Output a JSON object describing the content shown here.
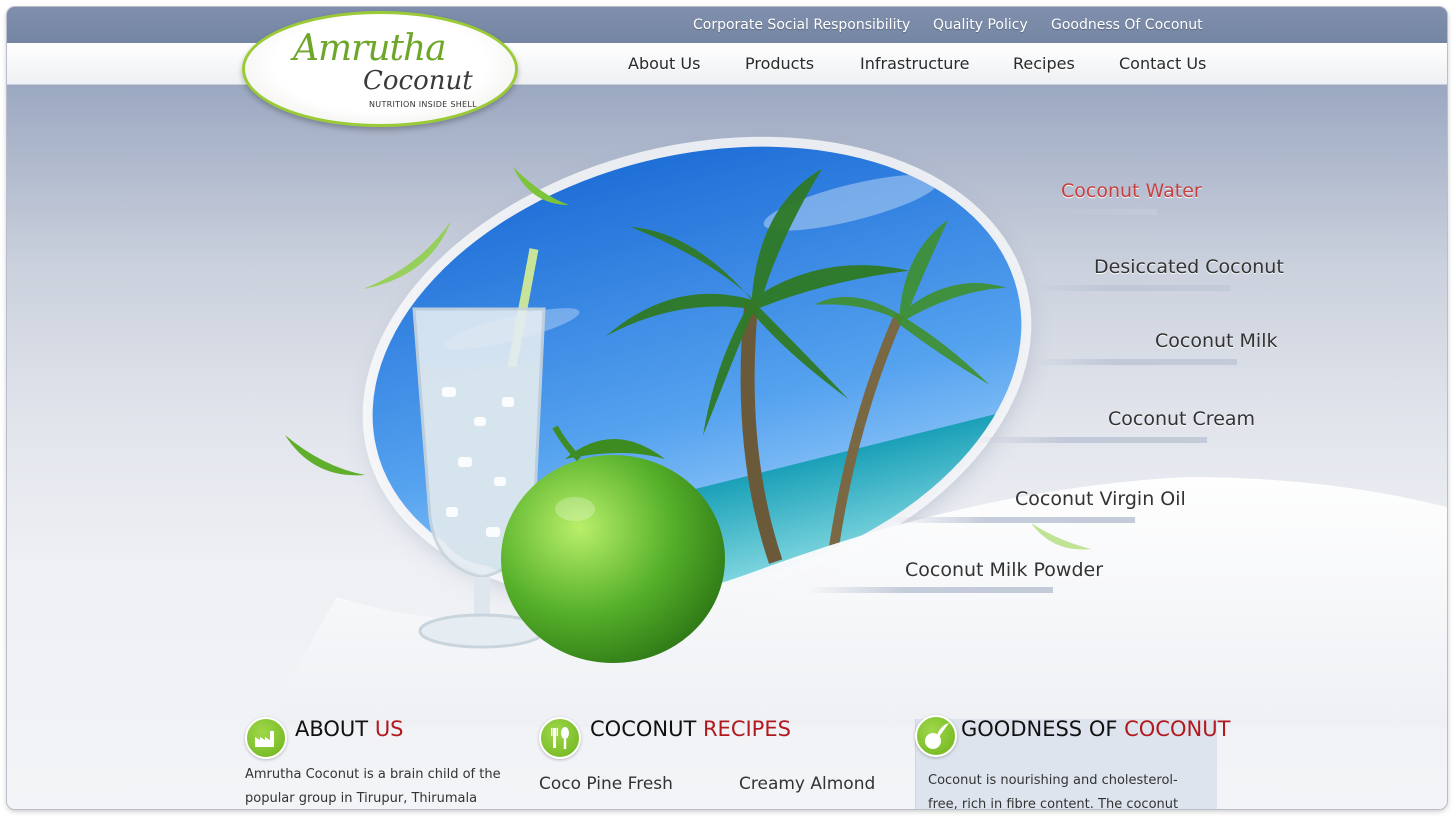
{
  "top_links": [
    {
      "label": "Corporate Social Responsibility"
    },
    {
      "label": "Quality Policy"
    },
    {
      "label": "Goodness Of Coconut"
    }
  ],
  "nav": [
    {
      "label": "About Us"
    },
    {
      "label": "Products"
    },
    {
      "label": "Infrastructure"
    },
    {
      "label": "Recipes"
    },
    {
      "label": "Contact Us"
    }
  ],
  "logo": {
    "line1": "Amrutha",
    "line2": "Coconut",
    "tagline": "NUTRITION INSIDE SHELL",
    "brand_green": "#6ea62a"
  },
  "products": [
    {
      "label": "Coconut Water",
      "active": true
    },
    {
      "label": "Desiccated Coconut"
    },
    {
      "label": "Coconut Milk"
    },
    {
      "label": "Coconut Cream"
    },
    {
      "label": "Coconut Virgin Oil"
    },
    {
      "label": "Coconut Milk Powder"
    }
  ],
  "about": {
    "title_a": "ABOUT ",
    "title_b": "US",
    "text_line1": "Amrutha Coconut is a brain child of the",
    "text_line2": "popular group in Tirupur, Thirumala",
    "icon": "factory-icon"
  },
  "recipes": {
    "title_a": "COCONUT ",
    "title_b": "RECIPES",
    "items": [
      "Coco Pine Fresh",
      "Creamy Almond"
    ],
    "icon": "fork-spoon-icon"
  },
  "goodness": {
    "title_a": "GOODNESS OF ",
    "title_b": "COCONUT",
    "text_line1": "Coconut is nourishing and cholesterol-",
    "text_line2": "free, rich in fibre content. The coconut",
    "icon": "coconut-leaf-icon"
  },
  "colors": {
    "accent_red": "#b2191e",
    "active_product": "#c5403f",
    "header_blue": "#7f8fac"
  }
}
